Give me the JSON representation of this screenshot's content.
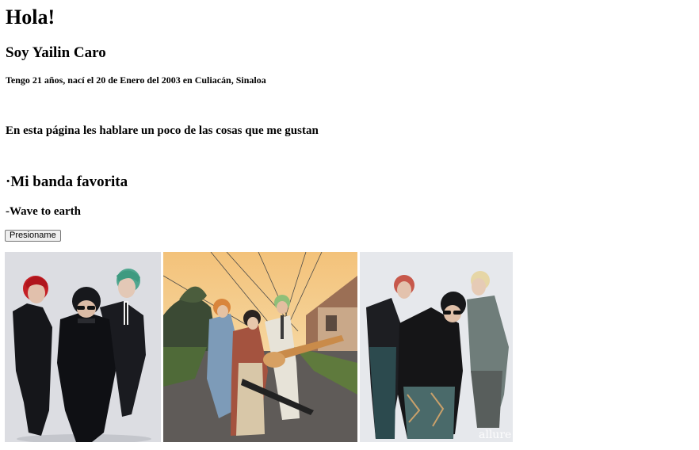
{
  "greeting": "Hola!",
  "name_heading": "Soy Yailin Caro",
  "bio": "Tengo 21 años, nací el 20 de Enero del 2003 en Culiacán, Sinaloa",
  "intro": "En esta página les hablare un poco de las cosas que me gustan",
  "section_title": "·Mi banda favorita",
  "band_name": "-Wave to earth",
  "button_label": "Presioname",
  "gallery": {
    "watermark": "allure"
  }
}
